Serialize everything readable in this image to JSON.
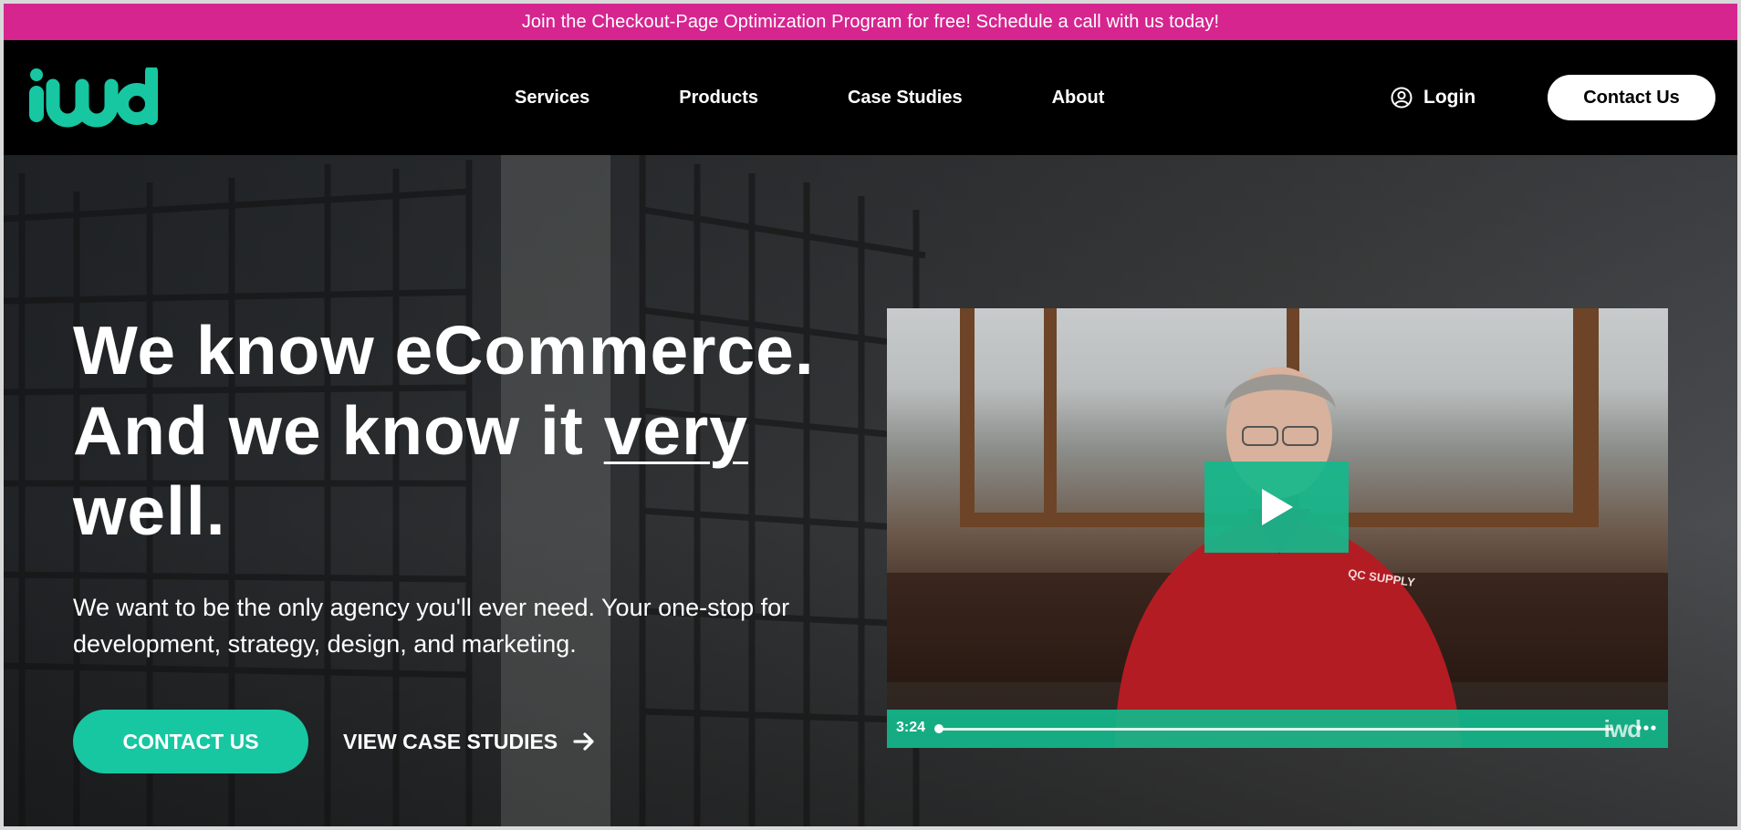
{
  "announcement": {
    "text": "Join the Checkout-Page Optimization Program for free! Schedule a call with us today!"
  },
  "brand": {
    "logo_text": "iwd",
    "accent": "#16c7a2",
    "banner_color": "#d6258f"
  },
  "nav": {
    "items": [
      {
        "label": "Services"
      },
      {
        "label": "Products"
      },
      {
        "label": "Case Studies"
      },
      {
        "label": "About"
      }
    ],
    "login_label": "Login",
    "contact_label": "Contact Us"
  },
  "hero": {
    "headline_line1": "We know eCommerce.",
    "headline_line2_pre": "And we know it ",
    "headline_line2_emph": "very",
    "headline_line3": "well.",
    "subtext": "We want to be the only agency you'll ever need. Your one-stop for development, strategy, design, and marketing.",
    "cta_primary": "CONTACT US",
    "cta_secondary": "VIEW CASE STUDIES"
  },
  "video": {
    "duration": "3:24",
    "watermark": "iwd",
    "shirt_text": "QC SUPPLY"
  }
}
